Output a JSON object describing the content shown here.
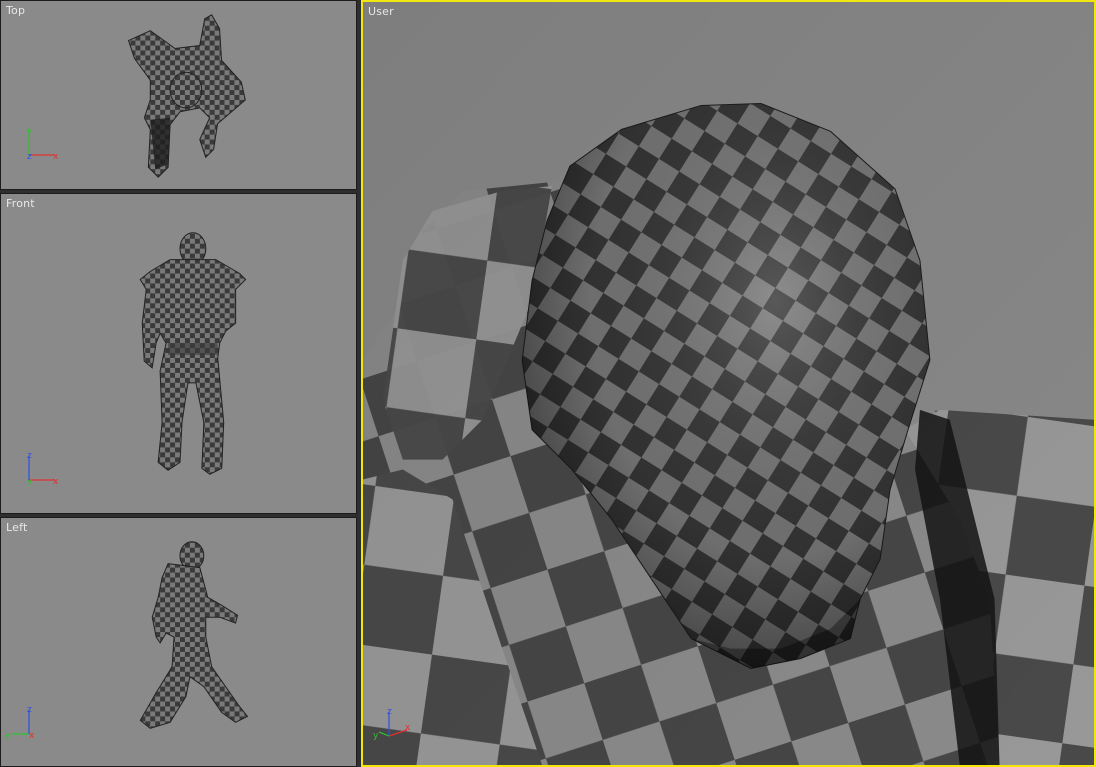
{
  "viewports": {
    "top": {
      "label": "Top"
    },
    "front": {
      "label": "Front"
    },
    "left": {
      "label": "Left"
    },
    "user": {
      "label": "User"
    }
  },
  "axes": {
    "x": "x",
    "y": "y",
    "z": "z"
  },
  "colors": {
    "viewport_bg": "#8a8a8a",
    "active_border": "#f1e60f",
    "checker_dark": "#3c3c3c",
    "checker_light": "#7a7a7a",
    "axis_x": "#e03030",
    "axis_y": "#30c030",
    "axis_z": "#3050e0"
  }
}
